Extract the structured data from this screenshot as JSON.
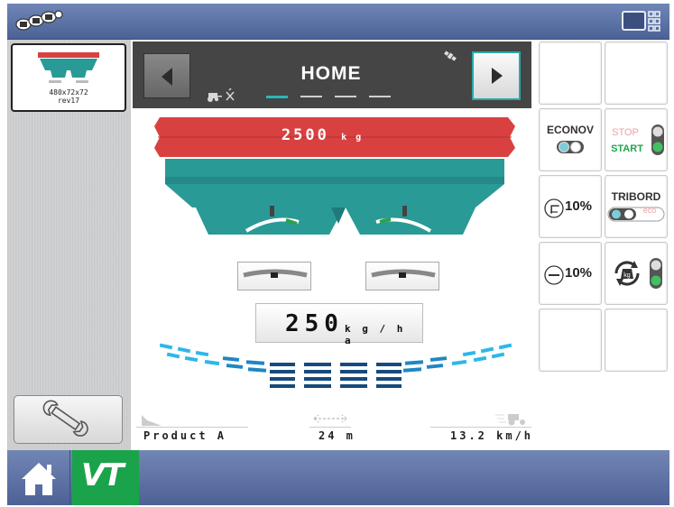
{
  "implement": {
    "caption_line1": "480x72x72",
    "caption_line2": "rev17"
  },
  "header": {
    "title": "HOME",
    "page_count": 4,
    "active_page": 0
  },
  "hopper": {
    "amount": "2500",
    "unit": "k g"
  },
  "application_rate": {
    "value": "250",
    "unit": "k g / h a"
  },
  "status_bar": {
    "product": "Product A",
    "width": "24 m",
    "speed": "13.2 km/h"
  },
  "controls": {
    "econov_label": "ECONOV",
    "stop_label": "STOP",
    "start_label": "START",
    "tribord_label": "TRIBORD",
    "eco_label": "eco",
    "left_rate_adjust": "10%",
    "right_rate_adjust": "10%",
    "kg_icon_label": "kg"
  },
  "icons": {
    "logo": "mom-logo",
    "screen_toggle": "screen-layout-icon",
    "wrench": "wrench-icon",
    "home": "home-icon",
    "vt": "VT",
    "prev": "arrow-left-icon",
    "next": "arrow-right-icon"
  },
  "colors": {
    "hopper_red": "#d94141",
    "teal": "#2a9a96",
    "accent_green": "#1aa34a",
    "topbar_blue": "#5a70a4",
    "start_green": "#1ea64a",
    "stop_red": "#f0a0a0"
  }
}
